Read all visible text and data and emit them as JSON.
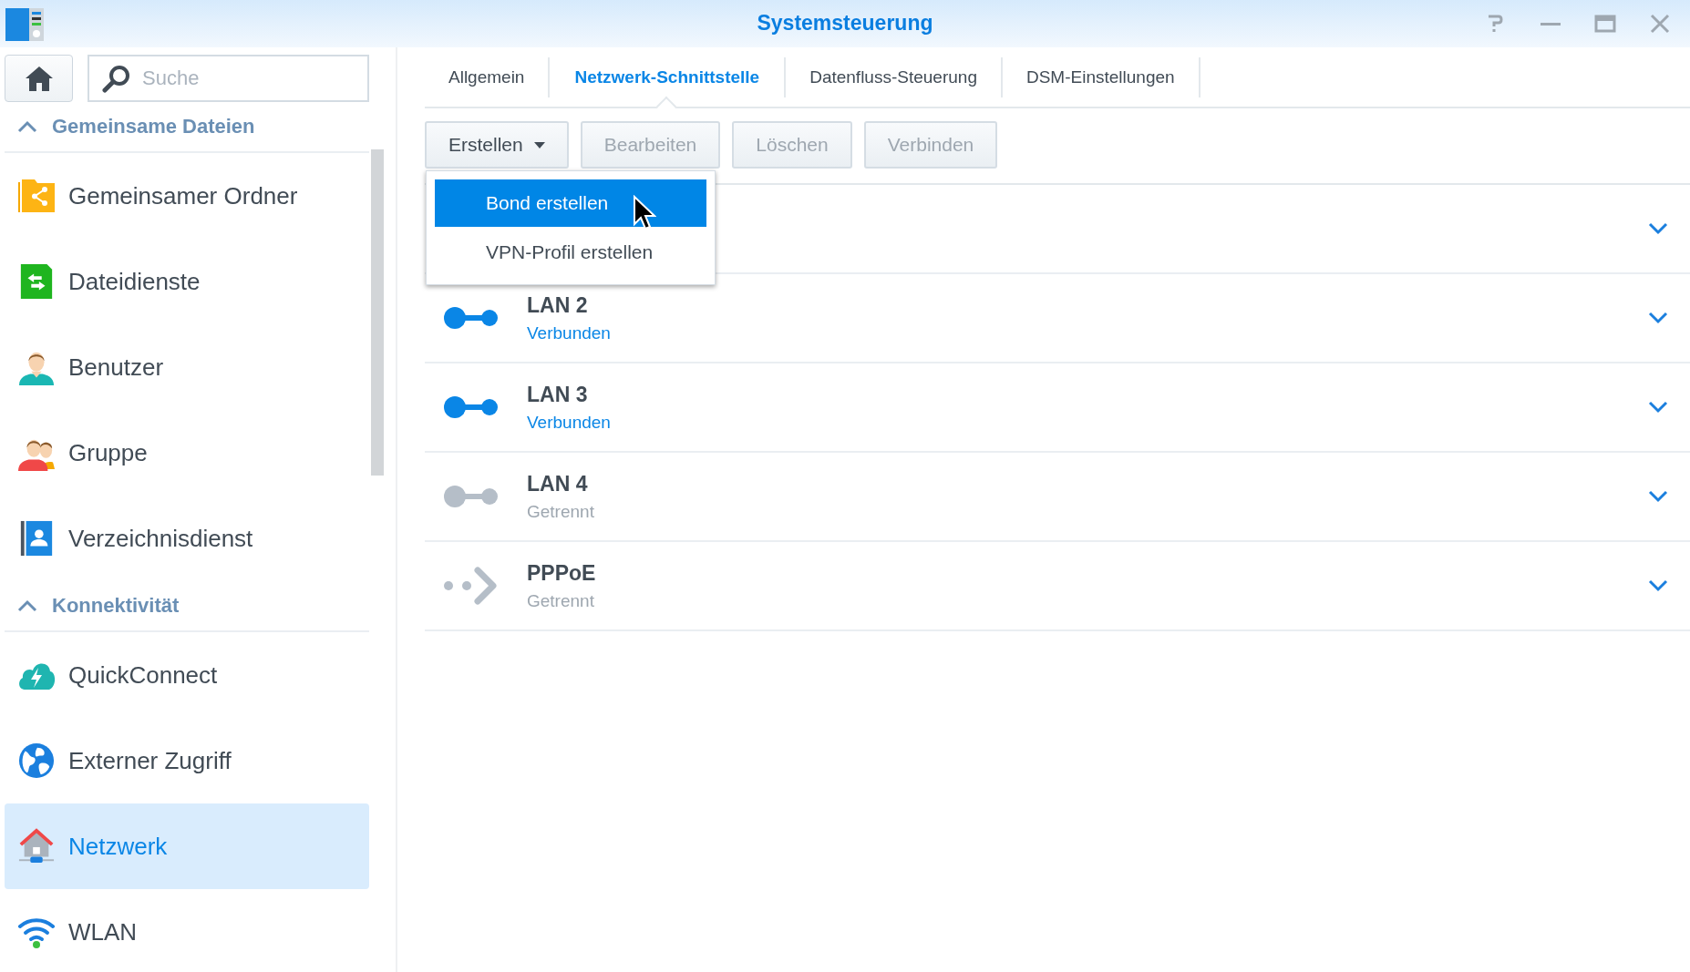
{
  "window": {
    "title": "Systemsteuerung"
  },
  "sidebar": {
    "search": {
      "placeholder": "Suche"
    },
    "sections": [
      {
        "title": "Gemeinsame Dateien",
        "expanded": true,
        "items": [
          {
            "kind": "shared-folder",
            "label": "Gemeinsamer Ordner",
            "selected": false
          },
          {
            "kind": "file-services",
            "label": "Dateidienste",
            "selected": false
          },
          {
            "kind": "user",
            "label": "Benutzer",
            "selected": false
          },
          {
            "kind": "group",
            "label": "Gruppe",
            "selected": false
          },
          {
            "kind": "directory",
            "label": "Verzeichnisdienst",
            "selected": false
          }
        ]
      },
      {
        "title": "Konnektivität",
        "expanded": true,
        "items": [
          {
            "kind": "quickconnect",
            "label": "QuickConnect",
            "selected": false
          },
          {
            "kind": "globe",
            "label": "Externer Zugriff",
            "selected": false
          },
          {
            "kind": "network",
            "label": "Netzwerk",
            "selected": true
          },
          {
            "kind": "wifi",
            "label": "WLAN",
            "selected": false
          }
        ]
      }
    ]
  },
  "tabs": [
    {
      "label": "Allgemein",
      "selected": false
    },
    {
      "label": "Netzwerk-Schnittstelle",
      "selected": true
    },
    {
      "label": "Datenfluss-Steuerung",
      "selected": false
    },
    {
      "label": "DSM-Einstellungen",
      "selected": false
    }
  ],
  "toolbar": {
    "buttons": [
      {
        "kind": "dropdown",
        "label": "Erstellen",
        "disabled": false
      },
      {
        "kind": "plain",
        "label": "Bearbeiten",
        "disabled": true
      },
      {
        "kind": "plain",
        "label": "Löschen",
        "disabled": true
      },
      {
        "kind": "plain",
        "label": "Verbinden",
        "disabled": true
      }
    ]
  },
  "menu": {
    "items": [
      {
        "label": "Bond erstellen",
        "selected": true
      },
      {
        "label": "VPN-Profil erstellen",
        "selected": false
      }
    ]
  },
  "interfaces": [
    {
      "kind": "covered"
    },
    {
      "kind": "lan",
      "name": "LAN 2",
      "status": "Verbunden",
      "connected": true
    },
    {
      "kind": "lan",
      "name": "LAN 3",
      "status": "Verbunden",
      "connected": true
    },
    {
      "kind": "lan",
      "name": "LAN 4",
      "status": "Getrennt",
      "connected": false
    },
    {
      "kind": "pppoe",
      "name": "PPPoE",
      "status": "Getrennt",
      "connected": false
    }
  ]
}
